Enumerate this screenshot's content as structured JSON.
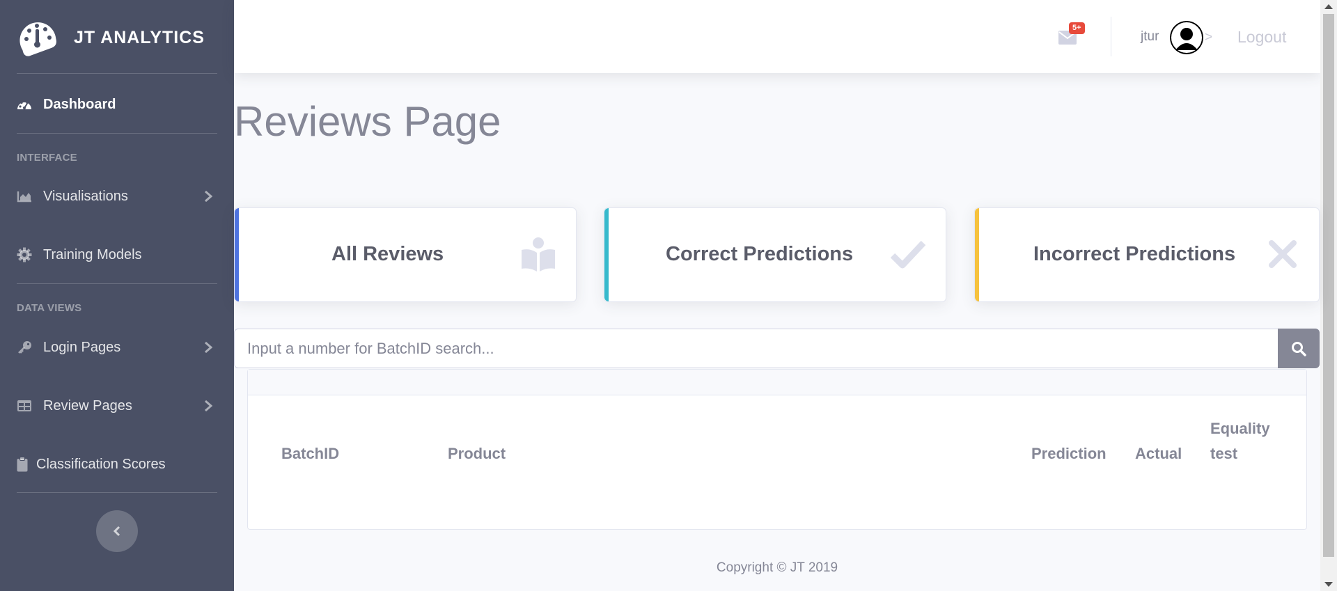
{
  "brand": {
    "name": "JT ANALYTICS"
  },
  "sidebar": {
    "dashboard": "Dashboard",
    "heading_interface": "INTERFACE",
    "visualisations": "Visualisations",
    "training_models": "Training Models",
    "heading_data_views": "DATA VIEWS",
    "login_pages": "Login Pages",
    "review_pages": "Review Pages",
    "classification_scores": "Classification Scores"
  },
  "topbar": {
    "mail_badge": "5+",
    "username": "jtur",
    "after_avatar": ">",
    "logout": "Logout"
  },
  "main": {
    "title": "Reviews Page",
    "cards": [
      {
        "label": "All Reviews",
        "accent": "#4e73df",
        "icon": "book-reader-icon"
      },
      {
        "label": "Correct Predictions",
        "accent": "#36b9cc",
        "icon": "check-icon"
      },
      {
        "label": "Incorrect Predictions",
        "accent": "#f6c23e",
        "icon": "times-icon"
      }
    ],
    "search": {
      "placeholder": "Input a number for BatchID search..."
    },
    "table": {
      "columns": [
        "BatchID",
        "Product",
        "Prediction",
        "Actual",
        "Equality",
        "test"
      ]
    }
  },
  "footer": {
    "text": "Copyright © JT 2019"
  }
}
